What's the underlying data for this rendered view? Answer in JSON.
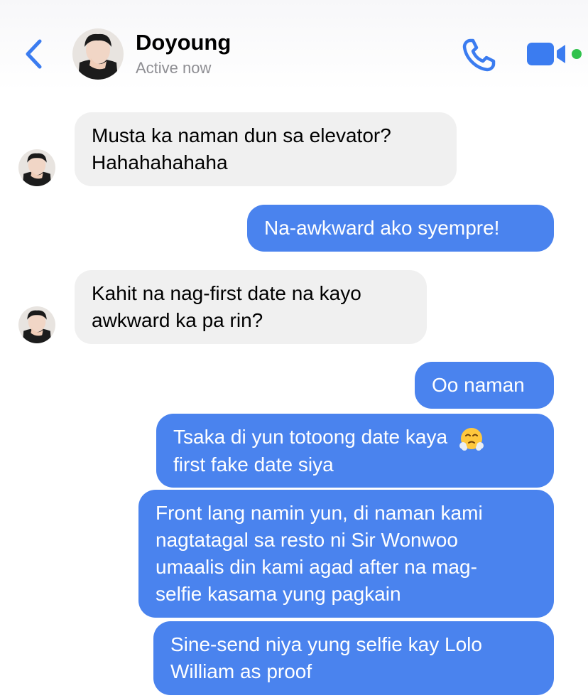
{
  "header": {
    "contact_name": "Doyoung",
    "status": "Active now",
    "accent_color": "#3b7cf0",
    "active_dot_color": "#31c24d",
    "icons": [
      "chevron-left-icon",
      "phone-icon",
      "video-camera-icon"
    ]
  },
  "messages": [
    {
      "direction": "incoming",
      "text": "Musta ka naman dun sa elevator?\nHahahahahaha"
    },
    {
      "direction": "outgoing",
      "text": "Na-awkward ako syempre!"
    },
    {
      "direction": "incoming",
      "text": "Kahit na nag-first date na kayo\nawkward ka pa rin?"
    },
    {
      "direction": "outgoing",
      "text": "Oo naman"
    },
    {
      "direction": "outgoing",
      "text_line1": "Tsaka di yun totoong date kaya",
      "text_line2": "first fake date siya",
      "emoji": "face-with-steam-icon"
    },
    {
      "direction": "outgoing",
      "text": "Front lang namin yun, di naman kami\nnagtatagal sa resto ni Sir Wonwoo\numaalis din kami agad after na mag-\nselfie kasama yung pagkain"
    },
    {
      "direction": "outgoing",
      "text": "Sine-send niya yung selfie kay Lolo\nWilliam as proof"
    }
  ],
  "colors": {
    "incoming_bubble": "#f0f0f0",
    "outgoing_bubble": "#4a83ee",
    "outgoing_text": "#ffffff"
  }
}
